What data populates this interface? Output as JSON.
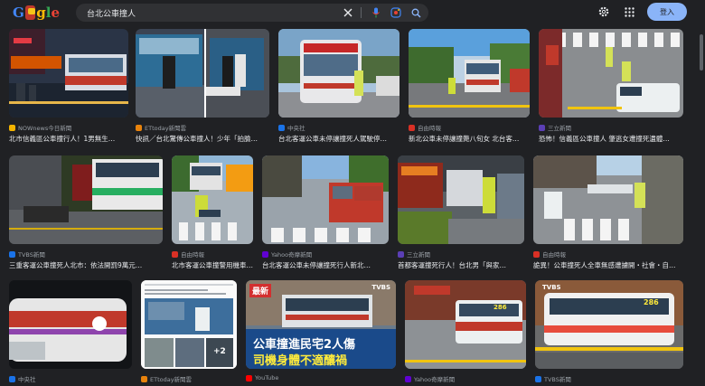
{
  "header": {
    "logo_letters": [
      "G",
      "o",
      "g",
      "l",
      "e"
    ],
    "query": "台北公車撞人",
    "signin_label": "登入",
    "icons": [
      "clear-icon",
      "mic-icon",
      "lens-icon",
      "search-icon",
      "settings-icon",
      "apps-icon"
    ]
  },
  "results": [
    {
      "source": "NOWnews今日新聞",
      "title": "北市信義區公車撞行人！1男無生…",
      "fav": "#f4b400"
    },
    {
      "source": "ETtoday新聞雲",
      "title": "快訊／台北驚傳公車撞人！少年「拍臉…",
      "fav": "#e8830c"
    },
    {
      "source": "中央社",
      "title": "台北客運公車未停讓撞死人駕駛停…",
      "fav": "#1a73e8"
    },
    {
      "source": "自由時報",
      "title": "新北公車未停讓撞斃八旬女 北台客…",
      "fav": "#d93025"
    },
    {
      "source": "三立新聞",
      "title": "恐怖！信義區公車撞人 肇逃女遭撞死遺體…",
      "fav": "#5b3fb5"
    },
    {
      "source": "TVBS新聞",
      "title": "三重客運公車撞死人北市：依法開罰9萬元…",
      "fav": "#1a73e8"
    },
    {
      "source": "自由時報",
      "title": "北市客運公車撞警用機車…",
      "fav": "#d93025"
    },
    {
      "source": "Yahoo奇摩新聞",
      "title": "台北客運公車未停讓撞死行人新北…",
      "fav": "#6001d2"
    },
    {
      "source": "三立新聞",
      "title": "首都客運撞死行人！台北男「與家…",
      "fav": "#5b3fb5"
    },
    {
      "source": "自由時報",
      "title": "詭異！公車撞死人全車無感遭擄開・社會・自…",
      "fav": "#d93025"
    },
    {
      "source": "中央社",
      "title": "",
      "fav": "#1a73e8"
    },
    {
      "source": "ETtoday新聞雲",
      "title": "",
      "fav": "#e8830c"
    },
    {
      "source": "YouTube",
      "title": "",
      "fav": "#ff0000"
    },
    {
      "source": "Yahoo奇摩新聞",
      "title": "",
      "fav": "#6001d2"
    },
    {
      "source": "TVBS新聞",
      "title": "",
      "fav": "#1a73e8"
    }
  ],
  "overlay_texts": {
    "headline_red": "最新",
    "headline_line1": "公車撞進民宅2人傷",
    "headline_line2": "司機身體不適釀禍",
    "tvbs": "TVBS",
    "plus_count": "+2",
    "bus_route_top": "286",
    "bus_route_2": "286"
  }
}
